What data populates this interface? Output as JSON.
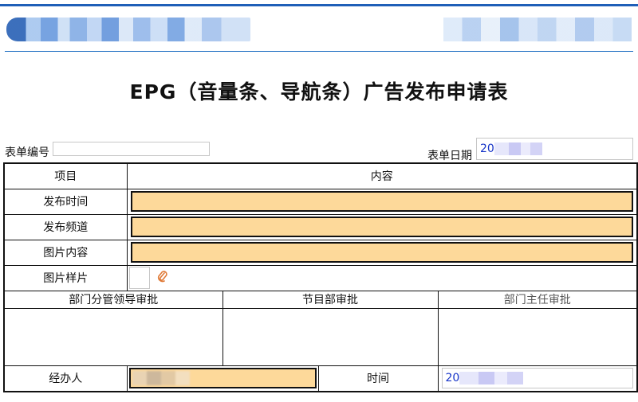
{
  "title": "EPG（音量条、导航条）广告发布申请表",
  "meta": {
    "form_no_label": "表单编号",
    "form_no_value": "",
    "form_date_label": "表单日期",
    "form_date_value": "20"
  },
  "table": {
    "header_item": "项目",
    "header_content": "内容",
    "rows": [
      {
        "label": "发布时间",
        "value": ""
      },
      {
        "label": "发布频道",
        "value": ""
      },
      {
        "label": "图片内容",
        "value": ""
      },
      {
        "label": "图片样片",
        "value": ""
      }
    ],
    "approvals": {
      "dept_leader": "部门分管领导审批",
      "program_dept": "节目部审批",
      "dept_director": "部门主任审批"
    },
    "handler_label": "经办人",
    "handler_value": "",
    "time_label": "时间",
    "time_value": "20"
  },
  "icons": {
    "attachment": "paperclip-icon"
  },
  "colors": {
    "field_fill": "#fdd99a",
    "accent_blue": "#1f5fb8",
    "date_text": "#1533c8"
  }
}
